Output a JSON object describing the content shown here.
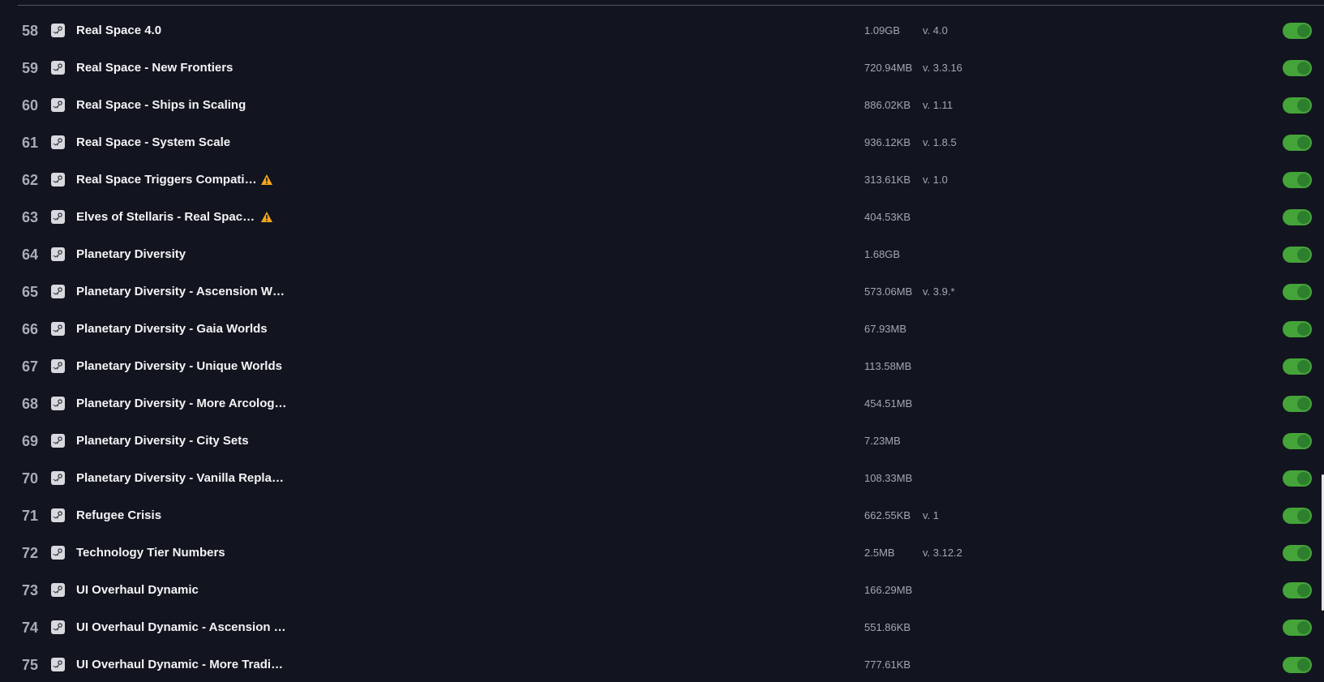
{
  "mods": [
    {
      "index": "58",
      "name": "Real Space 4.0",
      "size": "1.09GB",
      "version": "v. 4.0",
      "warning": false
    },
    {
      "index": "59",
      "name": "Real Space - New Frontiers",
      "size": "720.94MB",
      "version": "v. 3.3.16",
      "warning": false
    },
    {
      "index": "60",
      "name": "Real Space - Ships in Scaling",
      "size": "886.02KB",
      "version": "v. 1.11",
      "warning": false
    },
    {
      "index": "61",
      "name": "Real Space - System Scale",
      "size": "936.12KB",
      "version": "v. 1.8.5",
      "warning": false
    },
    {
      "index": "62",
      "name": "Real Space Triggers Compati…",
      "size": "313.61KB",
      "version": "v. 1.0",
      "warning": true
    },
    {
      "index": "63",
      "name": "Elves of Stellaris - Real Spac…",
      "size": "404.53KB",
      "version": "",
      "warning": true
    },
    {
      "index": "64",
      "name": "Planetary Diversity",
      "size": "1.68GB",
      "version": "",
      "warning": false
    },
    {
      "index": "65",
      "name": "Planetary Diversity - Ascension W…",
      "size": "573.06MB",
      "version": "v. 3.9.*",
      "warning": false
    },
    {
      "index": "66",
      "name": "Planetary Diversity - Gaia Worlds",
      "size": "67.93MB",
      "version": "",
      "warning": false
    },
    {
      "index": "67",
      "name": "Planetary Diversity - Unique Worlds",
      "size": "113.58MB",
      "version": "",
      "warning": false
    },
    {
      "index": "68",
      "name": "Planetary Diversity - More Arcolog…",
      "size": "454.51MB",
      "version": "",
      "warning": false
    },
    {
      "index": "69",
      "name": "Planetary Diversity - City Sets",
      "size": "7.23MB",
      "version": "",
      "warning": false
    },
    {
      "index": "70",
      "name": "Planetary Diversity - Vanilla Repla…",
      "size": "108.33MB",
      "version": "",
      "warning": false
    },
    {
      "index": "71",
      "name": "Refugee Crisis",
      "size": "662.55KB",
      "version": "v. 1",
      "warning": false
    },
    {
      "index": "72",
      "name": "Technology Tier Numbers",
      "size": "2.5MB",
      "version": "v. 3.12.2",
      "warning": false
    },
    {
      "index": "73",
      "name": "UI Overhaul Dynamic",
      "size": "166.29MB",
      "version": "",
      "warning": false
    },
    {
      "index": "74",
      "name": "UI Overhaul Dynamic - Ascension …",
      "size": "551.86KB",
      "version": "",
      "warning": false
    },
    {
      "index": "75",
      "name": "UI Overhaul Dynamic - More Tradi…",
      "size": "777.61KB",
      "version": "",
      "warning": false
    }
  ],
  "icons": {
    "source": "steam-icon",
    "warning": "warning-icon",
    "toggle": "enabled-toggle"
  },
  "colors": {
    "background": "#12151f",
    "text": "#f3f4f6",
    "muted": "#a2a7b1",
    "toggle_on": "#45a439",
    "warning": "#f4a51c"
  }
}
